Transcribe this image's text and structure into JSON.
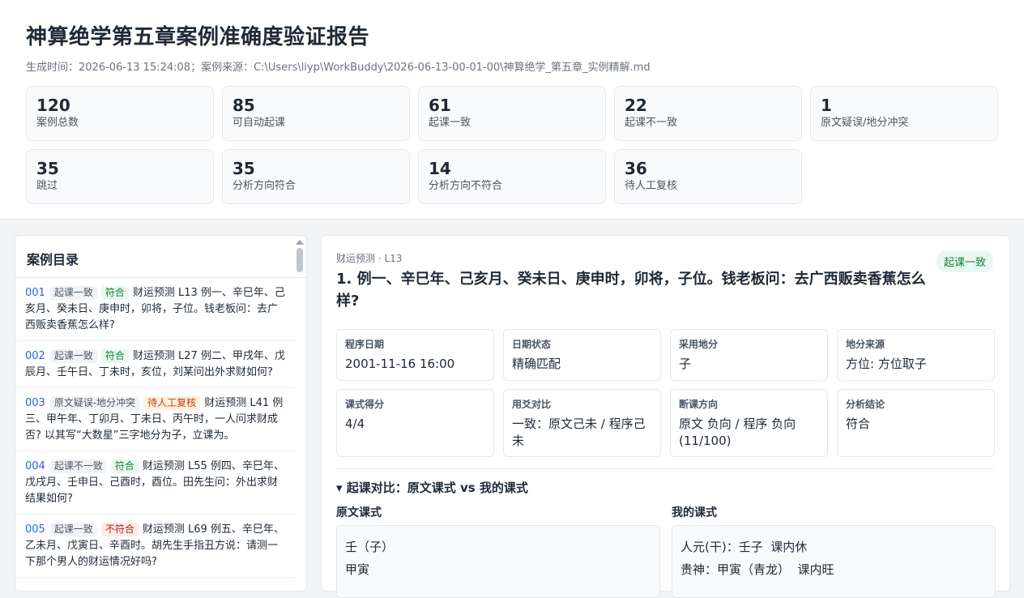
{
  "report": {
    "title": "神算绝学第五章案例准确度验证报告",
    "meta": "生成时间：2026-06-13 15:24:08；案例来源：C:\\Users\\liyp\\WorkBuddy\\2026-06-13-00-01-00\\神算绝学_第五章_实例精解.md"
  },
  "stats": [
    {
      "value": "120",
      "label": "案例总数"
    },
    {
      "value": "85",
      "label": "可自动起课"
    },
    {
      "value": "61",
      "label": "起课一致"
    },
    {
      "value": "22",
      "label": "起课不一致"
    },
    {
      "value": "1",
      "label": "原文疑误/地分冲突"
    },
    {
      "value": "35",
      "label": "跳过"
    },
    {
      "value": "35",
      "label": "分析方向符合"
    },
    {
      "value": "14",
      "label": "分析方向不符合"
    },
    {
      "value": "36",
      "label": "待人工复核"
    }
  ],
  "sidebar": {
    "title": "案例目录",
    "cases": [
      {
        "id": "001",
        "tag1": "起课一致",
        "tag2": "符合",
        "text": "财运预测 L13 例一、辛巳年、己亥月、癸未日、庚申时，卯将，子位。钱老板问：去广西贩卖香蕉怎么样?"
      },
      {
        "id": "002",
        "tag1": "起课一致",
        "tag2": "符合",
        "text": "财运预测 L27 例二、甲戌年、戊辰月、壬午日、丁未时，亥位，刘某问出外求财如何?"
      },
      {
        "id": "003",
        "tag1": "原文疑误-地分冲突",
        "tag2": "待人工复核",
        "text": "财运预测 L41 例三、甲午年、丁卯月、丁未日、丙午时，一人问求财成否? 以其写“大数星”三字地分为子，立课为。"
      },
      {
        "id": "004",
        "tag1": "起课不一致",
        "tag2": "符合",
        "text": "财运预测 L55 例四、辛巳年、戊戌月、壬申日、己酉时，酉位。田先生问：外出求财结果如何?"
      },
      {
        "id": "005",
        "tag1": "起课一致",
        "tag2": "不符合",
        "text": "财运预测 L69 例五、辛巳年、乙未月、戊寅日、辛酉时。胡先生手指丑方说：请测一下那个男人的财运情况好吗?"
      }
    ]
  },
  "detail": {
    "crumb": "财运预测 · L13",
    "status": "起课一致",
    "title": "1. 例一、辛巳年、己亥月、癸未日、庚申时，卯将，子位。钱老板问：去广西贩卖香蕉怎么样?",
    "fields": [
      {
        "label": "程序日期",
        "value": "2001-11-16 16:00"
      },
      {
        "label": "日期状态",
        "value": "精确匹配"
      },
      {
        "label": "采用地分",
        "value": "子"
      },
      {
        "label": "地分来源",
        "value": "方位: 方位取子"
      },
      {
        "label": "课式得分",
        "value": "4/4"
      },
      {
        "label": "用爻对比",
        "value": "一致：原文己未 / 程序己未"
      },
      {
        "label": "断课方向",
        "value": "原文 负向 / 程序 负向 (11/100)"
      },
      {
        "label": "分析结论",
        "value": "符合"
      }
    ],
    "compare_title": "▾ 起课对比：原文课式 vs 我的课式",
    "orig_label": "原文课式",
    "mine_label": "我的课式",
    "orig_lines": [
      "壬（子）",
      "甲寅"
    ],
    "mine_lines": [
      "人元(干)：壬子  课内休",
      "贵神：甲寅（青龙）  课内旺"
    ]
  }
}
